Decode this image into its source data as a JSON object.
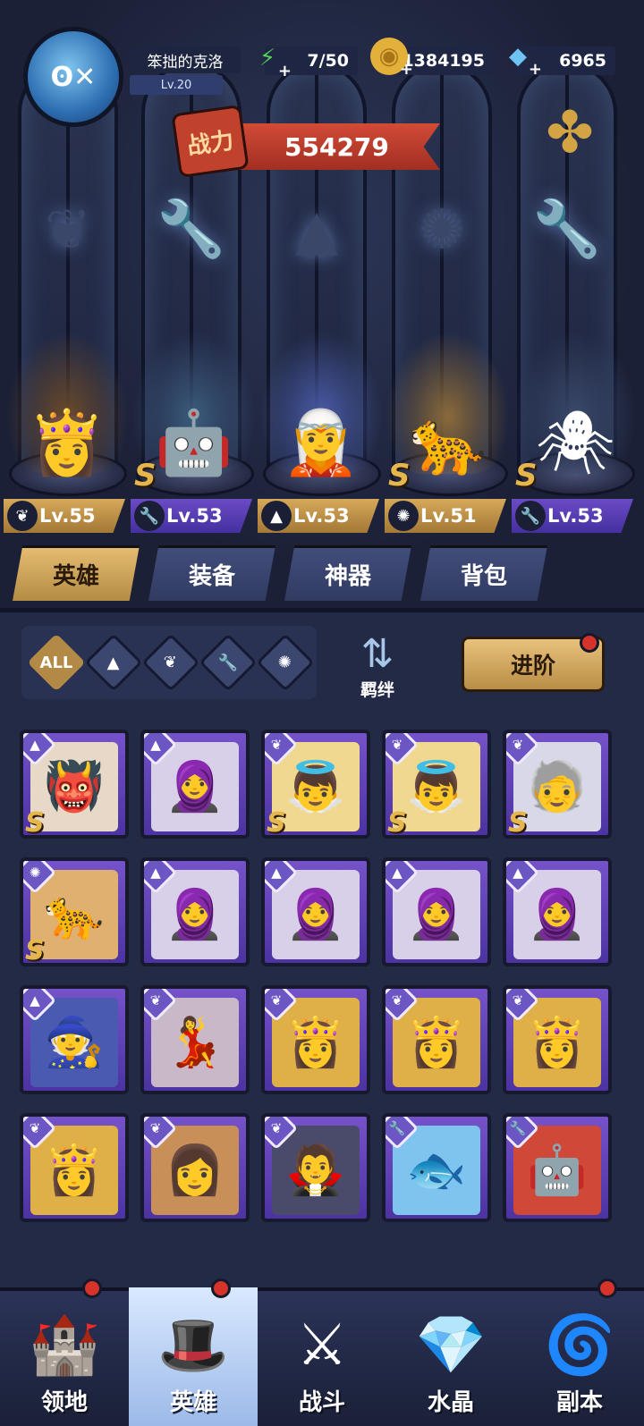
{
  "player": {
    "name": "笨拙的克洛",
    "level": "Lv.20"
  },
  "resources": {
    "energy": "7/50",
    "gold": "1384195",
    "diamonds": "6965"
  },
  "power": {
    "label": "战力",
    "value": "554279"
  },
  "team": [
    {
      "level": "Lv.55",
      "class_icon": "wing-icon",
      "tag_color": "gold",
      "s": false
    },
    {
      "level": "Lv.53",
      "class_icon": "wrench-icon",
      "tag_color": "purple",
      "s": true
    },
    {
      "level": "Lv.53",
      "class_icon": "hat-icon",
      "tag_color": "gold",
      "s": false
    },
    {
      "level": "Lv.51",
      "class_icon": "beast-icon",
      "tag_color": "gold",
      "s": true
    },
    {
      "level": "Lv.53",
      "class_icon": "wrench-icon",
      "tag_color": "purple",
      "s": true
    }
  ],
  "tabs": [
    "英雄",
    "装备",
    "神器",
    "背包"
  ],
  "filters": {
    "all": "ALL",
    "bond": "羁绊",
    "advance": "进阶"
  },
  "inventory": [
    {
      "class_icon": "hat-icon",
      "s": true
    },
    {
      "class_icon": "hat-icon",
      "s": false
    },
    {
      "class_icon": "wing-icon",
      "s": true
    },
    {
      "class_icon": "wing-icon",
      "s": true
    },
    {
      "class_icon": "wing-icon",
      "s": true
    },
    {
      "class_icon": "beast-icon",
      "s": true
    },
    {
      "class_icon": "hat-icon",
      "s": false
    },
    {
      "class_icon": "hat-icon",
      "s": false
    },
    {
      "class_icon": "hat-icon",
      "s": false
    },
    {
      "class_icon": "hat-icon",
      "s": false
    },
    {
      "class_icon": "hat-icon",
      "s": false
    },
    {
      "class_icon": "wing-icon",
      "s": false
    },
    {
      "class_icon": "wing-icon",
      "s": false
    },
    {
      "class_icon": "wing-icon",
      "s": false
    },
    {
      "class_icon": "wing-icon",
      "s": false
    },
    {
      "class_icon": "wing-icon",
      "s": false
    },
    {
      "class_icon": "wing-icon",
      "s": false
    },
    {
      "class_icon": "wing-icon",
      "s": false
    },
    {
      "class_icon": "wrench-icon",
      "s": false
    },
    {
      "class_icon": "wrench-icon",
      "s": false
    }
  ],
  "nav": [
    "领地",
    "英雄",
    "战斗",
    "水晶",
    "副本"
  ],
  "colors": {
    "gold": "#d6a95a",
    "purple": "#6a4bc5",
    "panel": "#232a45"
  }
}
